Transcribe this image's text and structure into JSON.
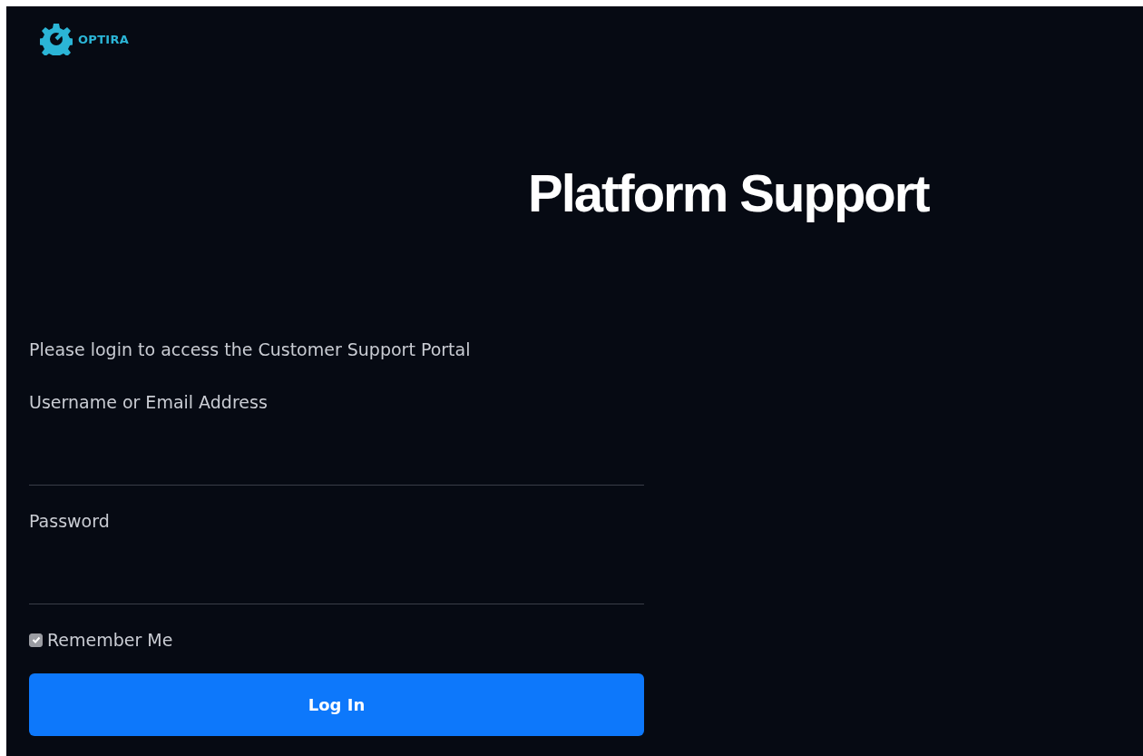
{
  "brand": {
    "name": "OPTIRA"
  },
  "title": "Platform Support",
  "intro": "Please login to access the Customer Support Portal",
  "fields": [
    {
      "label": "Username or Email Address"
    },
    {
      "label": "Password"
    }
  ],
  "remember": {
    "label": "Remember Me",
    "checked": true
  },
  "submit": "Log In"
}
